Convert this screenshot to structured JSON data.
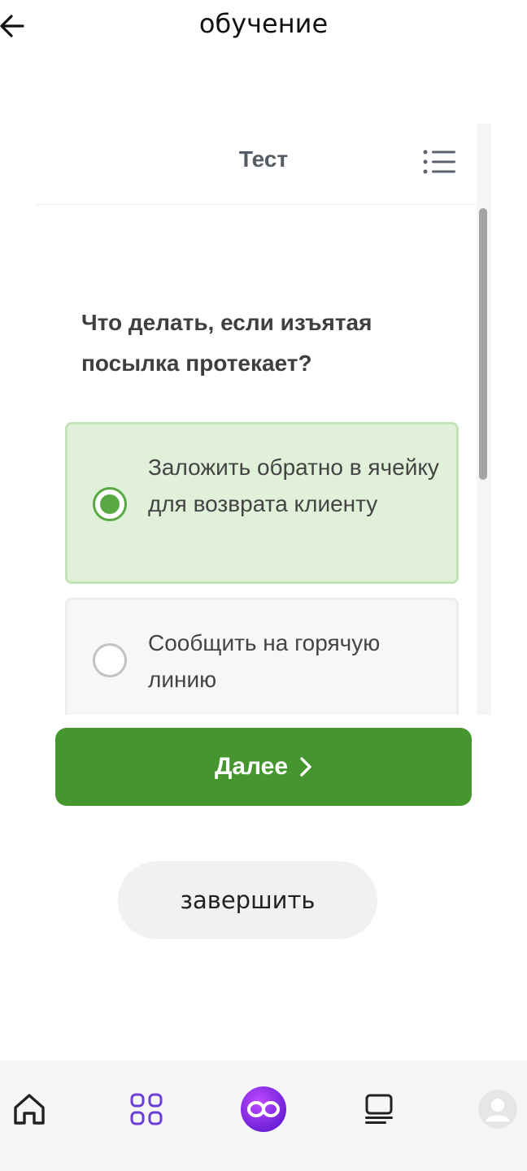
{
  "header": {
    "title": "обучение",
    "back_icon": "arrow-left-icon"
  },
  "card": {
    "title": "Тест",
    "menu_icon": "list-icon",
    "question": "Что делать, если изъятая посылка протекает?",
    "options": [
      {
        "label": "Заложить обратно в ячейку для возврата клиенту",
        "selected": true
      },
      {
        "label": "Сообщить на горячую линию",
        "selected": false
      }
    ]
  },
  "actions": {
    "next_label": "Далее",
    "finish_label": "завершить"
  },
  "tabbar": {
    "items": [
      {
        "icon": "home-icon"
      },
      {
        "icon": "grid-icon"
      },
      {
        "icon": "infinity-logo-icon"
      },
      {
        "icon": "courses-icon"
      },
      {
        "icon": "avatar-icon"
      }
    ]
  },
  "colors": {
    "accent_green": "#46962f",
    "selected_bg": "#e0f0d9",
    "brand_purple": "#7a2ee6"
  }
}
